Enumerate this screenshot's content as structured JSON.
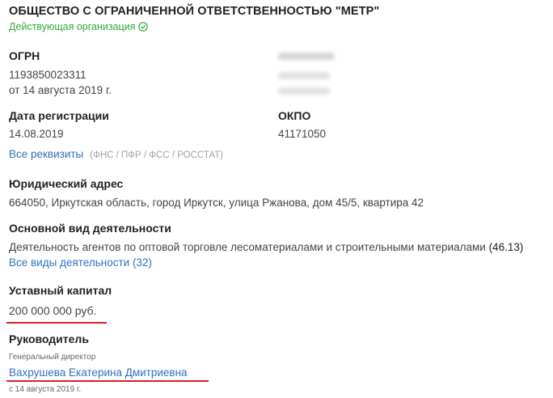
{
  "company": {
    "title": "ОБЩЕСТВО С ОГРАНИЧЕННОЙ ОТВЕТСТВЕННОСТЬЮ \"МЕТР\"",
    "status": "Действующая организация",
    "status_color": "#2eaa3c"
  },
  "ogrn": {
    "label": "ОГРН",
    "value": "1193850023311",
    "date": "от 14 августа 2019 г."
  },
  "registration": {
    "label": "Дата регистрации",
    "value": "14.08.2019"
  },
  "okpo": {
    "label": "ОКПО",
    "value": "41171050"
  },
  "requisites": {
    "link": "Все реквизиты",
    "sources": "(ФНС / ПФР / ФСС / РОССТАТ)"
  },
  "address": {
    "label": "Юридический адрес",
    "value": "664050, Иркутская область, город Иркутск, улица Ржанова, дом 45/5, квартира 42"
  },
  "activity": {
    "label": "Основной вид деятельности",
    "value": "Деятельность агентов по оптовой торговле лесоматериалами и строительными материалами",
    "code": "(46.13)",
    "link": "Все виды деятельности (32)"
  },
  "capital": {
    "label": "Уставный капитал",
    "value": "200 000 000 руб."
  },
  "director": {
    "label": "Руководитель",
    "position": "Генеральный директор",
    "name": "Вахрушева Екатерина Дмитриевна",
    "since": "с 14 августа 2019 г."
  },
  "colors": {
    "link": "#2f70c1",
    "annotation_red": "#d8202a"
  }
}
